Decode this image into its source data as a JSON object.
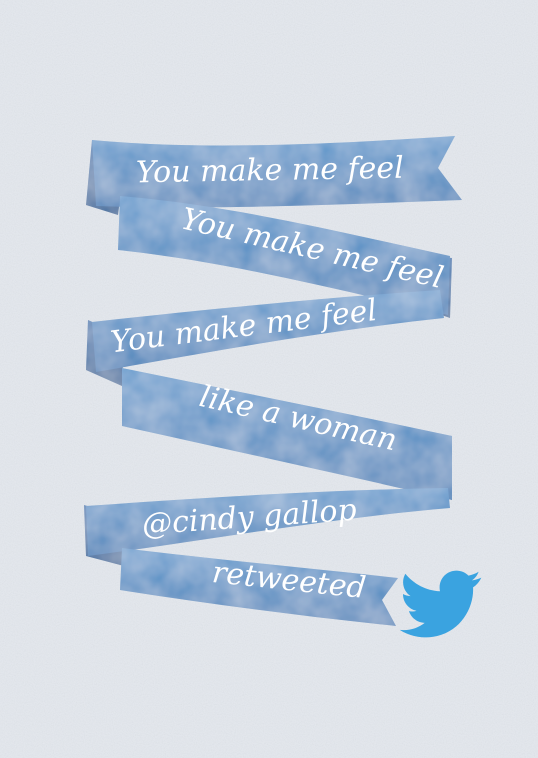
{
  "ribbon": {
    "lines": [
      "You make me feel",
      "You make me feel",
      "You make me feel",
      "like a woman",
      "@cindy gallop",
      "retweeted"
    ]
  },
  "colors": {
    "background": "#e4e8ee",
    "ribbon_front": "#4e8ac0",
    "ribbon_back": "#336fa7",
    "ribbon_shadow": "#2a5f93",
    "text": "#ffffff",
    "twitter_bird": "#3aa3e0"
  },
  "icons": [
    "twitter-bird-icon"
  ]
}
